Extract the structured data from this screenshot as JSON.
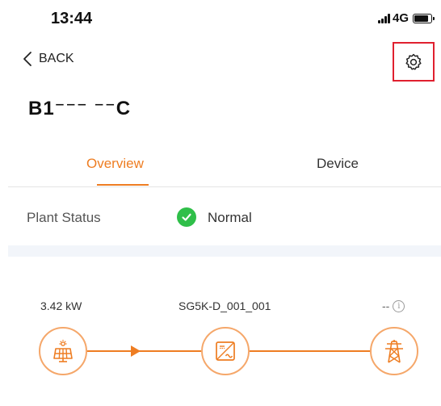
{
  "status_bar": {
    "time": "13:44",
    "network": "4G",
    "icons": [
      "signal-icon",
      "battery-icon"
    ]
  },
  "nav": {
    "back_label": "BACK",
    "settings_icon": "gear-icon",
    "highlight_color": "#e0202f"
  },
  "plant": {
    "name": "B1⁻⁻⁻ ⁻⁻C"
  },
  "tabs": [
    {
      "label": "Overview",
      "active": true
    },
    {
      "label": "Device",
      "active": false
    }
  ],
  "status": {
    "label": "Plant Status",
    "value": "Normal",
    "icon": "check-circle-icon",
    "color": "#2fbf49"
  },
  "flow": {
    "pv": {
      "value": "3.42 kW",
      "icon": "solar-panel-icon"
    },
    "inverter": {
      "name": "SG5K-D_001_001",
      "icon": "inverter-icon"
    },
    "grid": {
      "value": "--",
      "icon": "power-tower-icon",
      "info_icon": "info-icon"
    },
    "accent_color": "#ee7d22"
  }
}
